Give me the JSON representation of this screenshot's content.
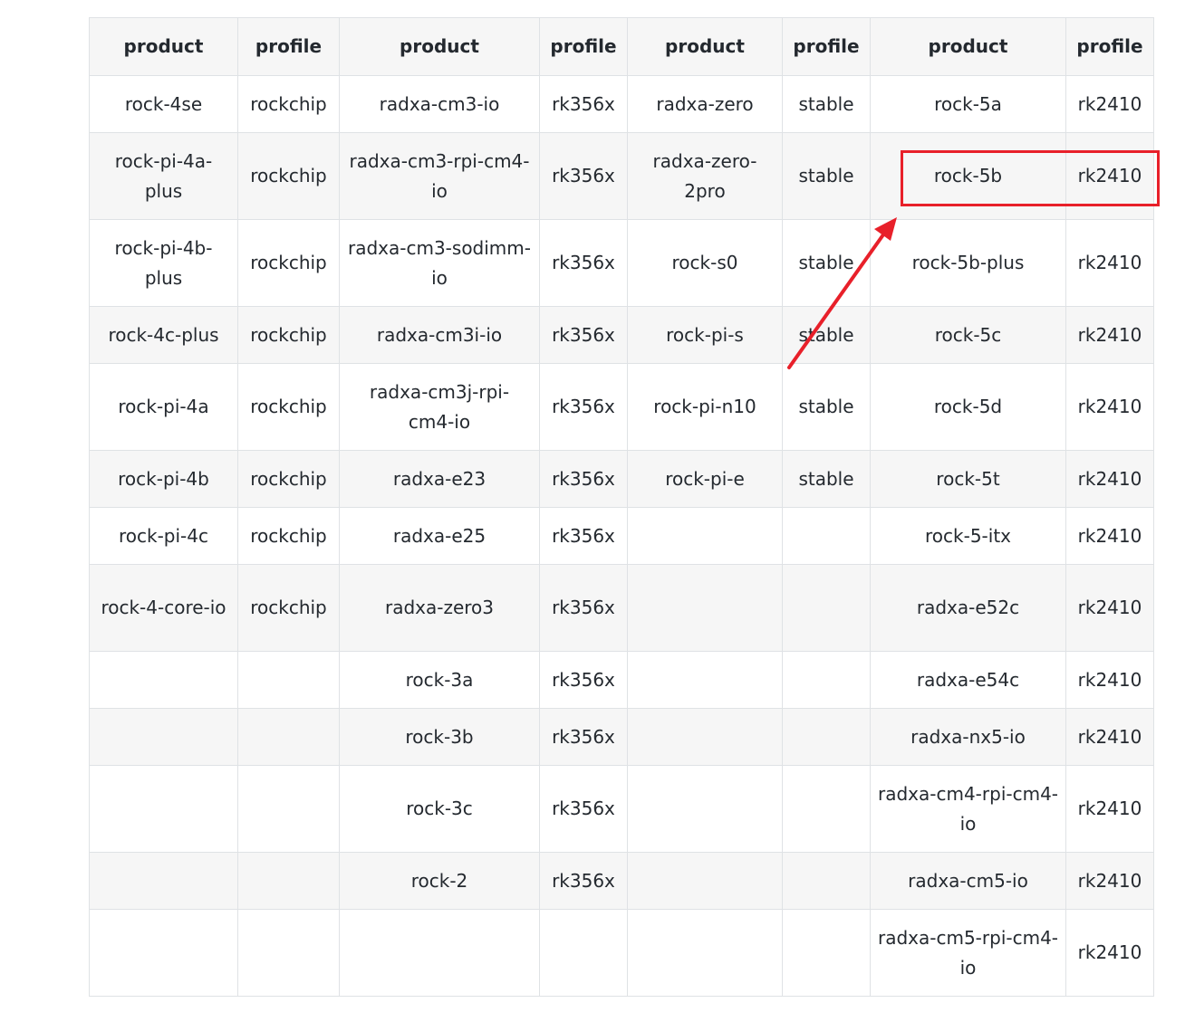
{
  "headers": [
    "product",
    "profile",
    "product",
    "profile",
    "product",
    "profile",
    "product",
    "profile"
  ],
  "rows": [
    [
      "rock-4se",
      "rockchip",
      "radxa-cm3-io",
      "rk356x",
      "radxa-zero",
      "stable",
      "rock-5a",
      "rk2410"
    ],
    [
      "rock-pi-4a-plus",
      "rockchip",
      "radxa-cm3-rpi-cm4-io",
      "rk356x",
      "radxa-zero-2pro",
      "stable",
      "rock-5b",
      "rk2410"
    ],
    [
      "rock-pi-4b-plus",
      "rockchip",
      "radxa-cm3-sodimm-io",
      "rk356x",
      "rock-s0",
      "stable",
      "rock-5b-plus",
      "rk2410"
    ],
    [
      "rock-4c-plus",
      "rockchip",
      "radxa-cm3i-io",
      "rk356x",
      "rock-pi-s",
      "stable",
      "rock-5c",
      "rk2410"
    ],
    [
      "rock-pi-4a",
      "rockchip",
      "radxa-cm3j-rpi-cm4-io",
      "rk356x",
      "rock-pi-n10",
      "stable",
      "rock-5d",
      "rk2410"
    ],
    [
      "rock-pi-4b",
      "rockchip",
      "radxa-e23",
      "rk356x",
      "rock-pi-e",
      "stable",
      "rock-5t",
      "rk2410"
    ],
    [
      "rock-pi-4c",
      "rockchip",
      "radxa-e25",
      "rk356x",
      "",
      "",
      "rock-5-itx",
      "rk2410"
    ],
    [
      "rock-4-core-io",
      "rockchip",
      "radxa-zero3",
      "rk356x",
      "",
      "",
      "radxa-e52c",
      "rk2410"
    ],
    [
      "",
      "",
      "rock-3a",
      "rk356x",
      "",
      "",
      "radxa-e54c",
      "rk2410"
    ],
    [
      "",
      "",
      "rock-3b",
      "rk356x",
      "",
      "",
      "radxa-nx5-io",
      "rk2410"
    ],
    [
      "",
      "",
      "rock-3c",
      "rk356x",
      "",
      "",
      "radxa-cm4-rpi-cm4-io",
      "rk2410"
    ],
    [
      "",
      "",
      "rock-2",
      "rk356x",
      "",
      "",
      "radxa-cm5-io",
      "rk2410"
    ],
    [
      "",
      "",
      "",
      "",
      "",
      "",
      "radxa-cm5-rpi-cm4-io",
      "rk2410"
    ]
  ],
  "annotation_color": "#e8202a"
}
